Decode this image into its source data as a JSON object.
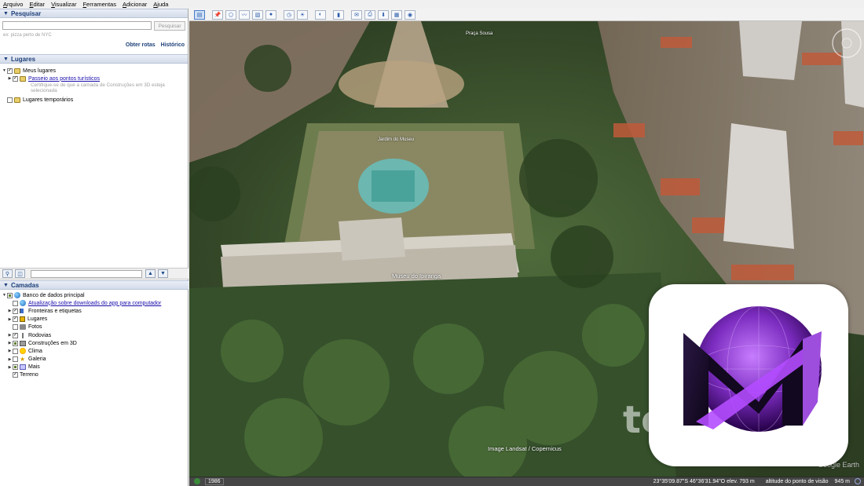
{
  "menu": [
    "Arquivo",
    "Editar",
    "Visualizar",
    "Ferramentas",
    "Adicionar",
    "Ajuda"
  ],
  "search": {
    "title": "Pesquisar",
    "input_value": "",
    "button_label": "Pesquisar",
    "hint": "ex: pizza perto de NYC",
    "link_routes": "Obter rotas",
    "link_history": "Histórico"
  },
  "places": {
    "title": "Lugares",
    "my_places": "Meus lugares",
    "tour_link": "Passeio aos pontos turísticos",
    "tour_note": "Certifique-se de que a camada de Construções em 3D esteja selecionada",
    "temp_places": "Lugares temporários"
  },
  "layers": {
    "title": "Camadas",
    "db": "Banco de dados principal",
    "update_link": "Atualização sobre downloads do app para computador",
    "items": [
      {
        "label": "Fronteiras e etiquetas",
        "checked": true,
        "icon": "flag-icon"
      },
      {
        "label": "Lugares",
        "checked": true,
        "icon": "pin-icon"
      },
      {
        "label": "Fotos",
        "checked": false,
        "icon": "camera-icon"
      },
      {
        "label": "Rodovias",
        "checked": true,
        "icon": "road-icon"
      },
      {
        "label": "Construções em 3D",
        "checked": "partial",
        "icon": "building-icon"
      },
      {
        "label": "Clima",
        "checked": false,
        "icon": "sun-icon"
      },
      {
        "label": "Galeria",
        "checked": false,
        "icon": "star-icon"
      },
      {
        "label": "Mais",
        "checked": "partial",
        "icon": "map-icon"
      }
    ],
    "terrain": "Terreno"
  },
  "map": {
    "label_museum": "Museu do Ipiranga",
    "label_street": "Praça Sousa",
    "label_garden": "Jardim do Museu",
    "attribution": "Image Landsat / Copernicus",
    "brand": "Google Earth",
    "watermark": "tec"
  },
  "status": {
    "year": "1986",
    "coords": "23°35'09.87\"S    46°36'31.94\"O  elev.  793 m",
    "eye_alt_label": "altitude do ponto de visão",
    "eye_alt_value": "945 m"
  },
  "colors": {
    "accent": "#1d3f79",
    "logo_purple": "#8a2be2",
    "logo_dark": "#1a0b2e"
  }
}
